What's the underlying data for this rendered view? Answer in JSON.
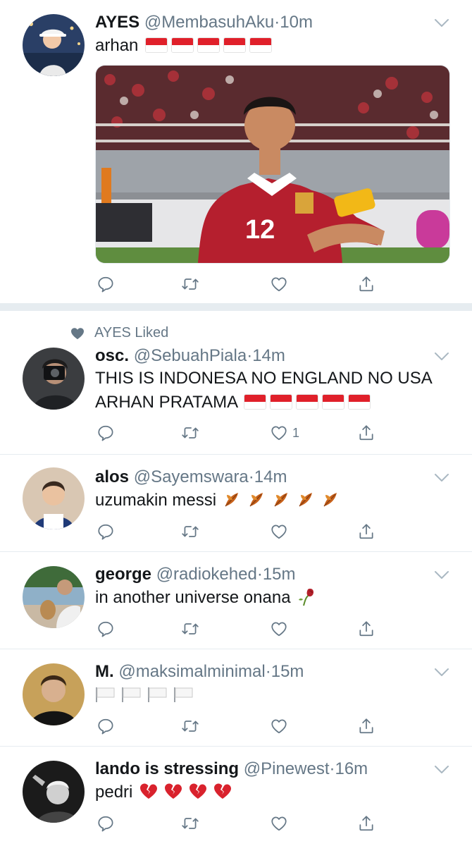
{
  "tweets": [
    {
      "name": "AYES",
      "handle": "@MembasuhAku",
      "time": "10m",
      "text": "arhan",
      "flags": 5
    },
    {
      "liked_by": "AYES Liked",
      "name": "osc.",
      "handle": "@SebuahPiala",
      "time": "14m",
      "text_line1": "THIS IS INDONESA NO ENGLAND NO USA",
      "text_line2": "ARHAN PRATAMA",
      "flags": 5,
      "like_count": "1"
    },
    {
      "name": "alos",
      "handle": "@Sayemswara",
      "time": "14m",
      "text": "uzumakin messi",
      "emoji": "fallen-leaf",
      "emoji_count": 5
    },
    {
      "name": "george",
      "handle": "@radiokehed",
      "time": "15m",
      "text": "in another universe onana",
      "emoji": "wilted-flower"
    },
    {
      "name": "M.",
      "handle": "@maksimalminimal",
      "time": "15m",
      "emoji": "white-flag",
      "emoji_count": 4
    },
    {
      "name": "lando is stressing",
      "handle": "@Pinewest",
      "time": "16m",
      "text": "pedri",
      "emoji": "broken-heart",
      "emoji_count": 4
    }
  ],
  "icons": {
    "reply": "reply-icon",
    "retweet": "retweet-icon",
    "like": "like-icon",
    "share": "share-icon",
    "menu": "chevron-down-icon"
  },
  "colors": {
    "secondary": "#657786",
    "divider": "#e6ecf0",
    "flag_red": "#e0202a"
  }
}
